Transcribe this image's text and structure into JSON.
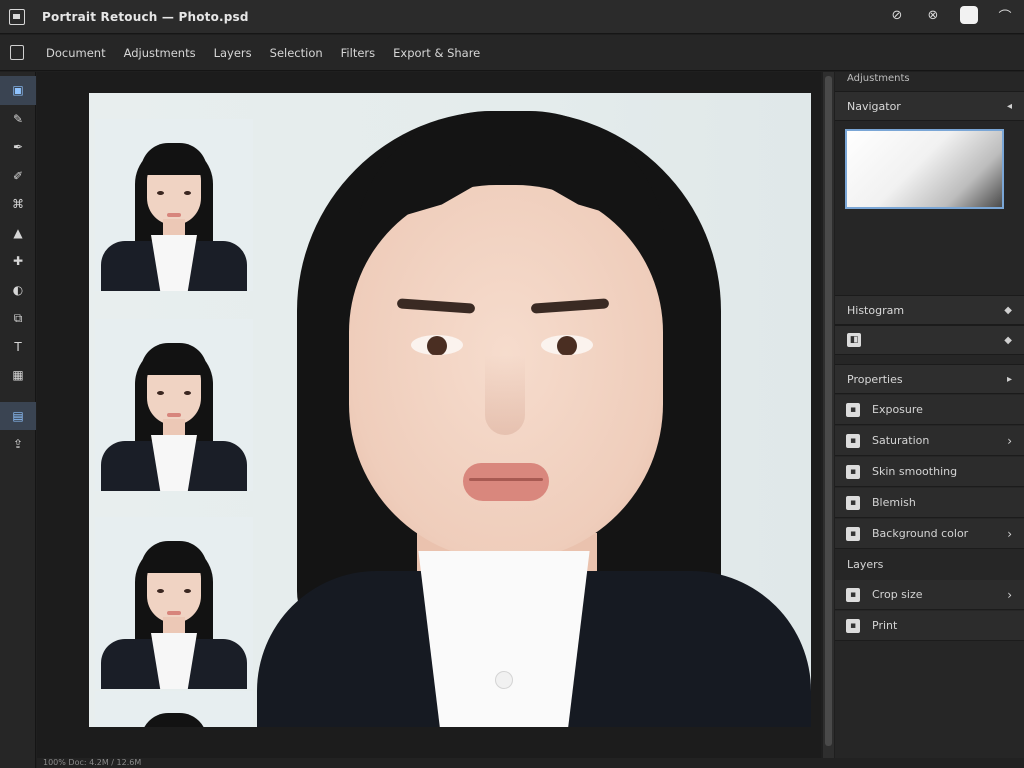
{
  "titlebar": {
    "title": "Portrait Retouch — Photo.psd",
    "actions": [
      "help-icon",
      "brush-icon",
      "white-square-icon",
      "minimize-icon"
    ]
  },
  "menubar": {
    "items": [
      "Document",
      "Adjustments",
      "Layers",
      "Selection",
      "Filters",
      "Export & Share"
    ]
  },
  "tools": [
    {
      "name": "image-tool-icon",
      "glyph": "▣",
      "active": true
    },
    {
      "name": "brush-tool-icon",
      "glyph": "✎",
      "active": false
    },
    {
      "name": "pen-tool-icon",
      "glyph": "✒",
      "active": false
    },
    {
      "name": "smudge-tool-icon",
      "glyph": "✐",
      "active": false
    },
    {
      "name": "stamp-tool-icon",
      "glyph": "⌘",
      "active": false
    },
    {
      "name": "sharpen-tool-icon",
      "glyph": "▲",
      "active": false
    },
    {
      "name": "heal-tool-icon",
      "glyph": "✚",
      "active": false
    },
    {
      "name": "dodge-tool-icon",
      "glyph": "◐",
      "active": false
    },
    {
      "name": "crop-tool-icon",
      "glyph": "⧉",
      "active": false
    },
    {
      "name": "text-tool-icon",
      "glyph": "T",
      "active": false
    },
    {
      "name": "grid-tool-icon",
      "glyph": "▦",
      "active": false
    },
    {
      "name": "layers-tool-icon",
      "glyph": "▤",
      "active": true
    },
    {
      "name": "export-tool-icon",
      "glyph": "⇪",
      "active": false
    }
  ],
  "right_panel": {
    "header": "Adjustments",
    "navigator": {
      "title": "Navigator",
      "caret": "◂"
    },
    "histogram": {
      "title": "Histogram",
      "caret": "◆"
    },
    "channels_row": {
      "label": "",
      "caret": "◆"
    },
    "properties": {
      "title": "Properties",
      "caret": "▸"
    },
    "rows": [
      {
        "icon": "brightness-icon",
        "label": "Exposure",
        "chevron": ""
      },
      {
        "icon": "contrast-icon",
        "label": "Saturation",
        "chevron": "›"
      },
      {
        "icon": "curves-icon",
        "label": "Skin smoothing",
        "chevron": ""
      },
      {
        "icon": "levels-icon",
        "label": "Blemish",
        "chevron": ""
      },
      {
        "icon": "color-icon",
        "label": "Background color",
        "chevron": "›"
      }
    ],
    "section_plain": "Layers",
    "rows2": [
      {
        "icon": "crop-icon",
        "label": "Crop size",
        "chevron": "›"
      },
      {
        "icon": "print-icon",
        "label": "Print",
        "chevron": ""
      }
    ]
  },
  "statusbar": "100%   Doc: 4.2M / 12.6M"
}
